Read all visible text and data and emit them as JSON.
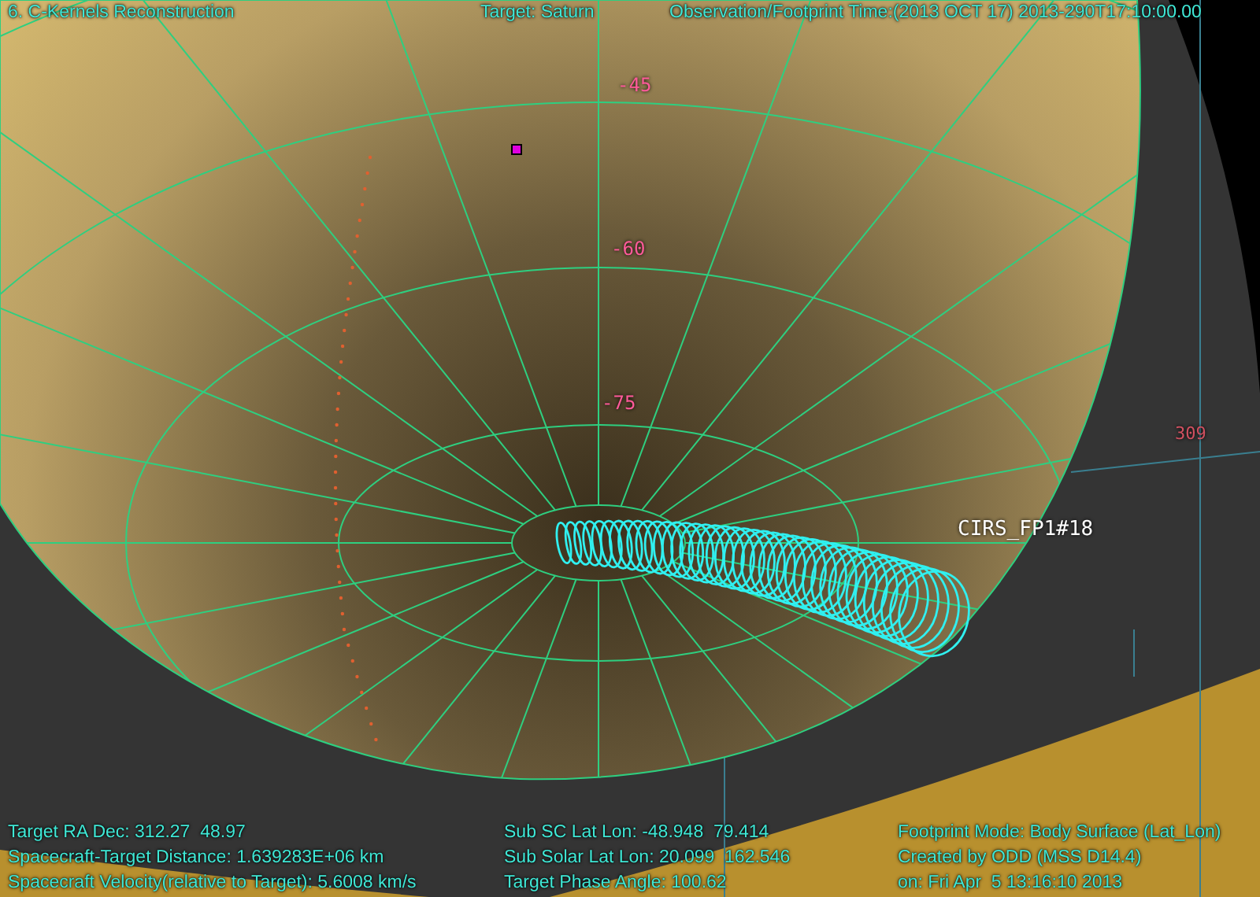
{
  "header": {
    "title": "6. C-Kernels Reconstruction",
    "target": "Target: Saturn",
    "time": "Observation/Footprint Time:(2013 OCT 17) 2013-290T17:10:00.00"
  },
  "grid_labels": [
    "-45",
    "-60",
    "-75",
    "309"
  ],
  "footprint_label": "CIRS_FP1#18",
  "footer": {
    "columns": [
      [
        "Target RA Dec: 312.27  48.97",
        "Spacecraft-Target Distance: 1.639283E+06 km",
        "Spacecraft Velocity(relative to Target): 5.6008 km/s"
      ],
      [
        "Sub SC Lat Lon: -48.948  79.414",
        "Sub Solar Lat Lon: 20.099  162.546",
        "Target Phase Angle: 100.62"
      ],
      [
        "Footprint Mode: Body Surface (Lat_Lon)",
        "Created by ODD (MSS D14.4)",
        "on: Fri Apr  5 13:16:10 2013"
      ]
    ]
  }
}
